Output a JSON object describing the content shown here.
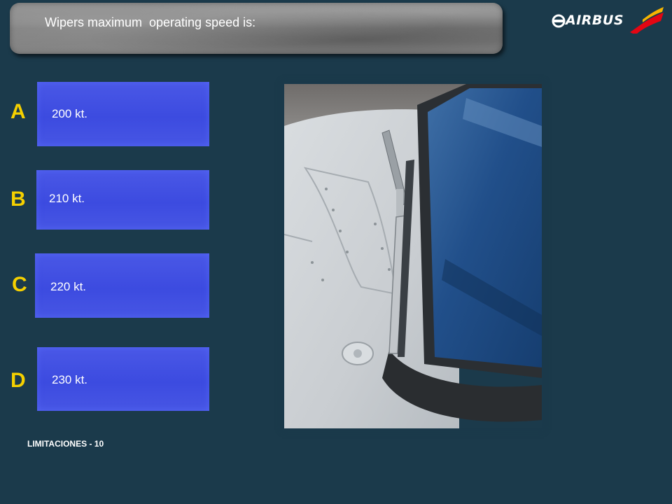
{
  "question": {
    "text": "Wipers maximum  operating speed is:"
  },
  "logo": {
    "text": "AIRBUS",
    "icon": "airbus-logo-icon",
    "brand_colors": [
      "#e30613",
      "#f7b500"
    ]
  },
  "answers": [
    {
      "letter": "A",
      "value": "200 kt."
    },
    {
      "letter": "B",
      "value": "210 kt."
    },
    {
      "letter": "C",
      "value": "220 kt."
    },
    {
      "letter": "D",
      "value": "230 kt."
    }
  ],
  "image": {
    "icon": "windshield-wiper-photo"
  },
  "footer": {
    "text": "LIMITACIONES - 10"
  },
  "colors": {
    "background": "#1b3a4b",
    "letter": "#f5d000",
    "answer_box": "#4251e2"
  }
}
